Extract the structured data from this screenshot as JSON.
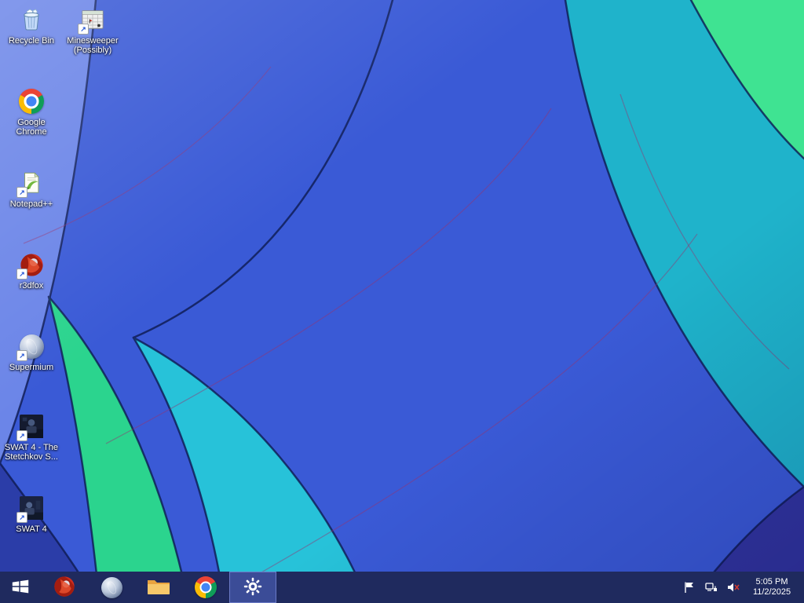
{
  "wallpaper": {
    "colors": {
      "base_blue": "#3a5ad6",
      "periwinkle": "#6b85e8",
      "dark_bottom_left": "#2b3da8",
      "green_left": "#2bd48e",
      "cyan_left": "#27c2d9",
      "teal_right": "#1fb3cb",
      "green_right": "#3fe392",
      "purple_bottom_right": "#32359f",
      "seam": "#0e1a50"
    }
  },
  "desktop": {
    "icons": [
      {
        "id": "recycle-bin",
        "label": "Recycle Bin",
        "shortcut": false
      },
      {
        "id": "minesweeper",
        "label": "Minesweeper (Possibly)",
        "shortcut": true
      },
      {
        "id": "google-chrome",
        "label": "Google Chrome",
        "shortcut": false
      },
      {
        "id": "notepad-plus-plus",
        "label": "Notepad++",
        "shortcut": true
      },
      {
        "id": "r3dfox",
        "label": "r3dfox",
        "shortcut": true
      },
      {
        "id": "supermium",
        "label": "Supermium",
        "shortcut": true
      },
      {
        "id": "swat4-stetchkov",
        "label": "SWAT 4 - The Stetchkov S...",
        "shortcut": true
      },
      {
        "id": "swat4",
        "label": "SWAT 4",
        "shortcut": true
      }
    ]
  },
  "taskbar": {
    "items": [
      {
        "id": "start"
      },
      {
        "id": "r3dfox"
      },
      {
        "id": "supermium"
      },
      {
        "id": "file-explorer"
      },
      {
        "id": "google-chrome"
      },
      {
        "id": "settings",
        "active": true
      }
    ],
    "tray": {
      "time": "5:05 PM",
      "date": "11/2/2025"
    }
  }
}
